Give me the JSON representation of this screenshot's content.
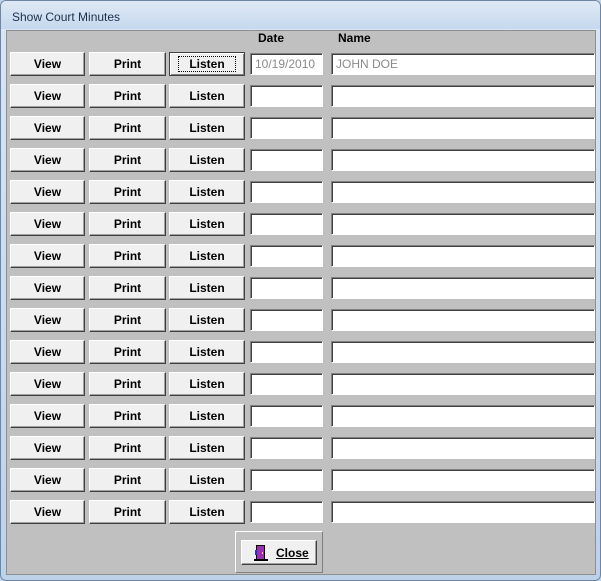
{
  "window": {
    "title": "Show Court Minutes"
  },
  "headers": {
    "date": "Date",
    "name": "Name"
  },
  "button_labels": {
    "view": "View",
    "print": "Print",
    "listen": "Listen"
  },
  "rows": [
    {
      "date": "10/19/2010",
      "name": "JOHN DOE"
    },
    {
      "date": "",
      "name": ""
    },
    {
      "date": "",
      "name": ""
    },
    {
      "date": "",
      "name": ""
    },
    {
      "date": "",
      "name": ""
    },
    {
      "date": "",
      "name": ""
    },
    {
      "date": "",
      "name": ""
    },
    {
      "date": "",
      "name": ""
    },
    {
      "date": "",
      "name": ""
    },
    {
      "date": "",
      "name": ""
    },
    {
      "date": "",
      "name": ""
    },
    {
      "date": "",
      "name": ""
    },
    {
      "date": "",
      "name": ""
    },
    {
      "date": "",
      "name": ""
    },
    {
      "date": "",
      "name": ""
    }
  ],
  "footer": {
    "close_label": "Close",
    "close_icon": "door-exit-icon"
  },
  "colors": {
    "client_bg": "#c0c0c0",
    "button_face": "#f0f0f0",
    "disabled_text": "#8a8a8a"
  }
}
